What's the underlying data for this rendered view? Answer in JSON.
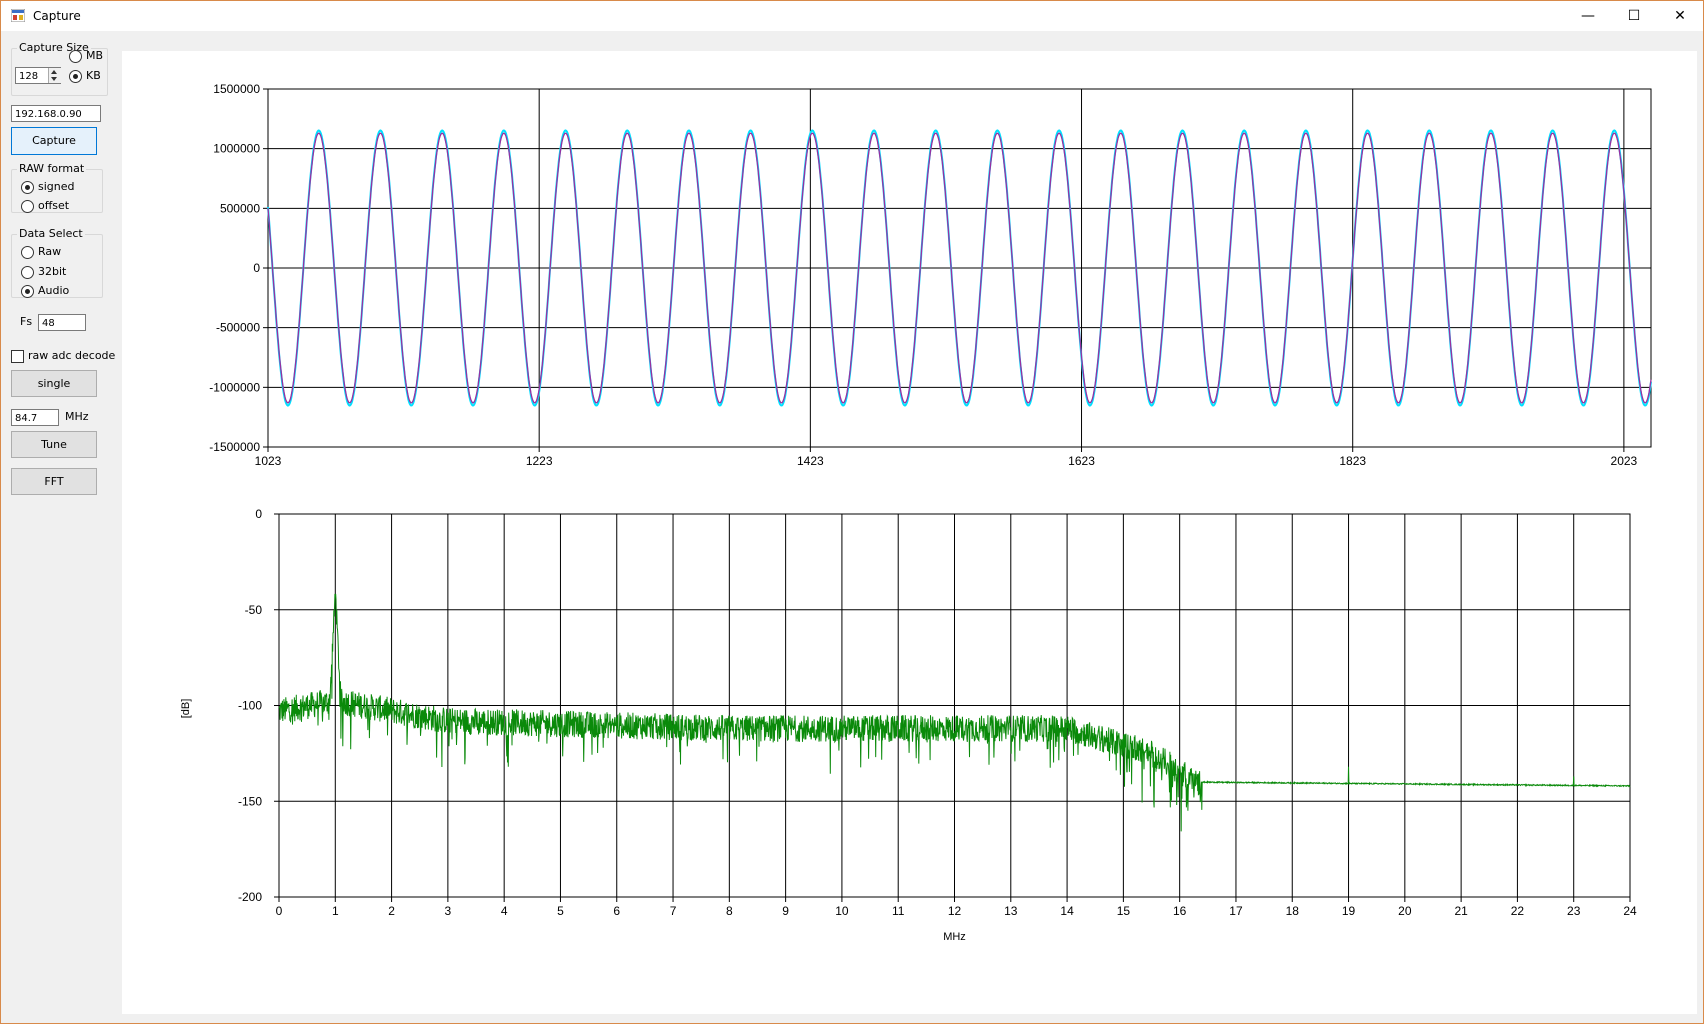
{
  "window": {
    "title": "Capture"
  },
  "title_buttons": {
    "minimize": "—",
    "maximize": "☐",
    "close": "✕"
  },
  "capture_size": {
    "label": "Capture Size",
    "value": "128",
    "options": [
      {
        "label": "MB",
        "selected": false
      },
      {
        "label": "KB",
        "selected": true
      }
    ]
  },
  "ip_address": "192.168.0.90",
  "capture_button": "Capture",
  "raw_format": {
    "label": "RAW format",
    "options": [
      {
        "label": "signed",
        "selected": true
      },
      {
        "label": "offset",
        "selected": false
      }
    ]
  },
  "data_select": {
    "label": "Data Select",
    "options": [
      {
        "label": "Raw",
        "selected": false
      },
      {
        "label": "32bit",
        "selected": false
      },
      {
        "label": "Audio",
        "selected": true
      }
    ]
  },
  "fs": {
    "label": "Fs",
    "value": "48"
  },
  "raw_adc_decode": {
    "label": "raw adc decode",
    "checked": false
  },
  "single_button": "single",
  "frequency": {
    "value": "84.7",
    "unit": "MHz"
  },
  "tune_button": "Tune",
  "fft_button": "FFT",
  "colors": {
    "wave_ch1": "#00e0ff",
    "wave_ch2": "#9a2fa0",
    "spectrum": "#0a8a0a",
    "grid": "#000000"
  },
  "chart_data": [
    {
      "type": "line",
      "title": "",
      "xlabel": "",
      "ylabel": "",
      "xlim": [
        1023,
        2043
      ],
      "ylim": [
        -1500000,
        1500000
      ],
      "x_ticks": [
        "1023",
        "1223",
        "1423",
        "1623",
        "1823",
        "2023"
      ],
      "y_ticks": [
        "1500000",
        "1000000",
        "500000",
        "0",
        "-500000",
        "-1000000",
        "-1500000"
      ],
      "grid": true,
      "series": [
        {
          "color": "#00e0ff",
          "amplitude": 1130000,
          "period_samples": 45.5,
          "start_value": 500000
        },
        {
          "color": "#9a2fa0",
          "amplitude": 1130000,
          "period_samples": 45.5,
          "start_value": 500000
        }
      ]
    },
    {
      "type": "line",
      "title": "",
      "xlabel": "MHz",
      "ylabel": "[dB]",
      "xlim": [
        0,
        24
      ],
      "ylim": [
        -200,
        0
      ],
      "x_ticks": [
        "0",
        "1",
        "2",
        "3",
        "4",
        "5",
        "6",
        "7",
        "8",
        "9",
        "10",
        "11",
        "12",
        "13",
        "14",
        "15",
        "16",
        "17",
        "18",
        "19",
        "20",
        "21",
        "22",
        "23",
        "24"
      ],
      "y_ticks": [
        "0",
        "-50",
        "-100",
        "-150",
        "-200"
      ],
      "grid": true,
      "series": [
        {
          "color": "#0a8a0a",
          "envelope": [
            {
              "x": 0,
              "y": -103
            },
            {
              "x": 0.9,
              "y": -98
            },
            {
              "x": 1.0,
              "y": -42
            },
            {
              "x": 1.1,
              "y": -98
            },
            {
              "x": 3,
              "y": -108
            },
            {
              "x": 8,
              "y": -112
            },
            {
              "x": 14,
              "y": -112
            },
            {
              "x": 15.5,
              "y": -125
            },
            {
              "x": 16.3,
              "y": -140
            },
            {
              "x": 24,
              "y": -142
            }
          ],
          "spurs": [
            {
              "x": 19,
              "y": -132
            },
            {
              "x": 23,
              "y": -137
            }
          ]
        }
      ]
    }
  ]
}
